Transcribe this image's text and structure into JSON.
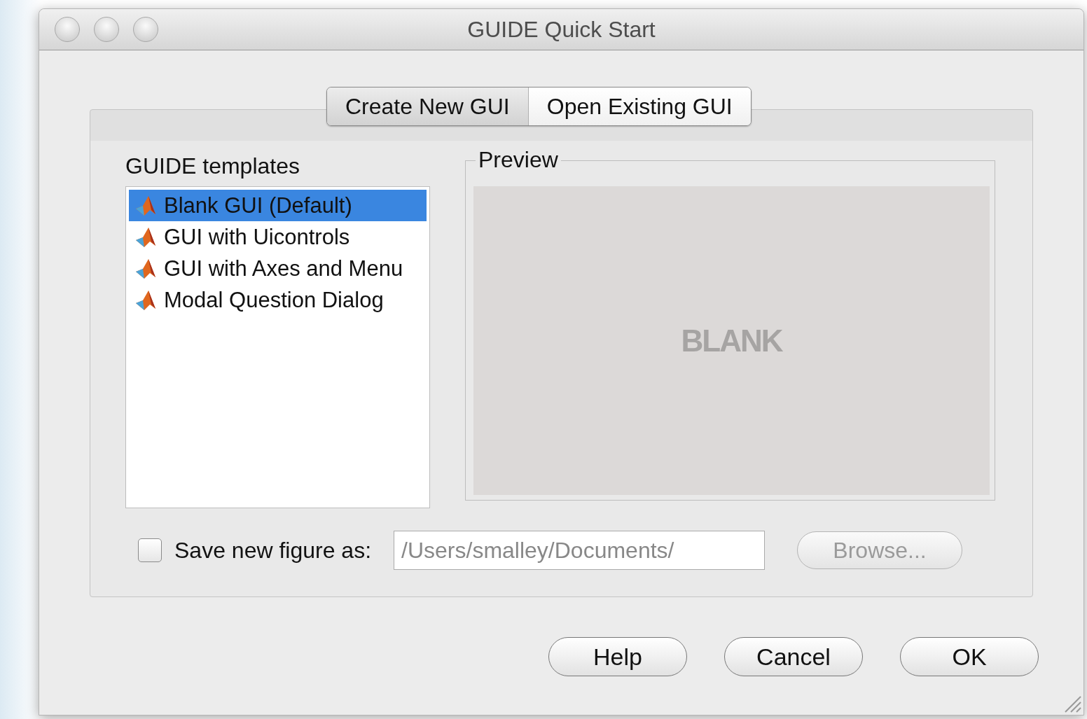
{
  "window": {
    "title": "GUIDE Quick Start"
  },
  "tabs": [
    {
      "label": "Create New GUI",
      "selected": true
    },
    {
      "label": "Open Existing GUI",
      "selected": false
    }
  ],
  "templates": {
    "label": "GUIDE templates",
    "items": [
      {
        "label": "Blank GUI (Default)",
        "selected": true
      },
      {
        "label": "GUI with Uicontrols",
        "selected": false
      },
      {
        "label": "GUI with Axes and Menu",
        "selected": false
      },
      {
        "label": "Modal Question Dialog",
        "selected": false
      }
    ]
  },
  "preview": {
    "label": "Preview",
    "text": "BLANK"
  },
  "save": {
    "label": "Save new figure as:",
    "checked": false,
    "value": "/Users/smalley/Documents/",
    "disabled": true,
    "browse": {
      "label": "Browse...",
      "disabled": true
    }
  },
  "buttons": [
    "Help",
    "Cancel",
    "OK"
  ]
}
